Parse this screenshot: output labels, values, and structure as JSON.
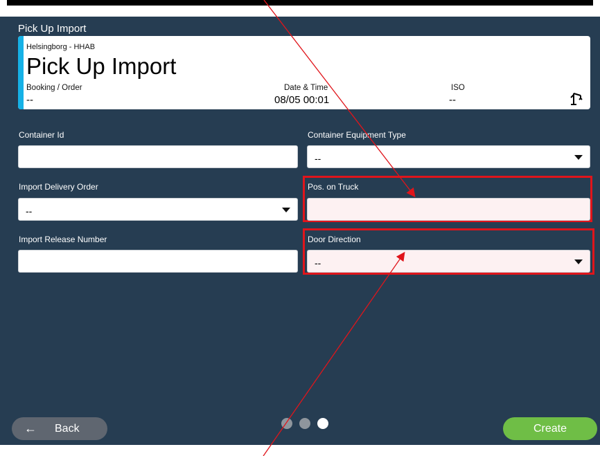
{
  "screen": {
    "title": "Pick Up Import"
  },
  "header": {
    "location": "Helsingborg - HHAB",
    "title": "Pick Up Import",
    "booking_label": "Booking / Order",
    "booking_value": "--",
    "datetime_label": "Date & Time",
    "datetime_value": "08/05 00:01",
    "iso_label": "ISO",
    "iso_value": "--",
    "icon": "crane-icon"
  },
  "fields": {
    "container_id": {
      "label": "Container Id",
      "value": ""
    },
    "equipment_type": {
      "label": "Container Equipment Type",
      "value": "--"
    },
    "delivery_order": {
      "label": "Import Delivery Order",
      "value": "--"
    },
    "pos_on_truck": {
      "label": "Pos. on Truck",
      "value": ""
    },
    "release_number": {
      "label": "Import Release Number",
      "value": ""
    },
    "door_direction": {
      "label": "Door Direction",
      "value": "--"
    }
  },
  "footer": {
    "back_label": "Back",
    "back_icon": "arrow-left-icon",
    "create_label": "Create",
    "page_dots": {
      "count": 3,
      "active": 3
    }
  },
  "colors": {
    "background": "#263d52",
    "accent": "#16b1e6",
    "create": "#6fbe46",
    "highlight": "#e0151b"
  }
}
